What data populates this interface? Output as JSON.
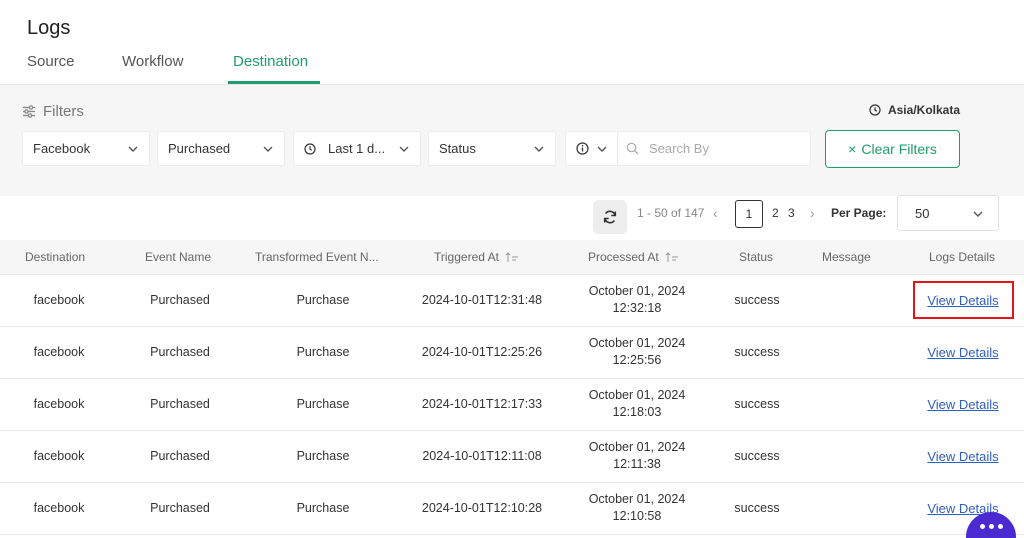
{
  "page": {
    "title": "Logs"
  },
  "tabs": [
    {
      "label": "Source",
      "active": false
    },
    {
      "label": "Workflow",
      "active": false
    },
    {
      "label": "Destination",
      "active": true
    }
  ],
  "filters": {
    "label": "Filters",
    "timezone": "Asia/Kolkata",
    "destination_select": "Facebook",
    "event_select": "Purchased",
    "time_select": "Last 1 d...",
    "status_select": "Status",
    "search_placeholder": "Search By",
    "clear_label": "Clear Filters",
    "clear_icon": "×"
  },
  "pagination": {
    "range_text": "1 - 50 of 147",
    "prev": "‹",
    "next": "›",
    "current_page": "1",
    "pages": [
      "2",
      "3"
    ],
    "per_page_label": "Per Page:",
    "per_page_value": "50"
  },
  "table": {
    "columns": [
      "Destination",
      "Event Name",
      "Transformed Event N...",
      "Triggered At",
      "Processed At",
      "Status",
      "Message",
      "Logs Details"
    ],
    "rows": [
      {
        "destination": "facebook",
        "event_name": "Purchased",
        "transformed": "Purchase",
        "triggered_at": "2024-10-01T12:31:48",
        "processed_date": "October 01, 2024",
        "processed_time": "12:32:18",
        "status": "success",
        "message": "",
        "details": "View Details"
      },
      {
        "destination": "facebook",
        "event_name": "Purchased",
        "transformed": "Purchase",
        "triggered_at": "2024-10-01T12:25:26",
        "processed_date": "October 01, 2024",
        "processed_time": "12:25:56",
        "status": "success",
        "message": "",
        "details": "View Details"
      },
      {
        "destination": "facebook",
        "event_name": "Purchased",
        "transformed": "Purchase",
        "triggered_at": "2024-10-01T12:17:33",
        "processed_date": "October 01, 2024",
        "processed_time": "12:18:03",
        "status": "success",
        "message": "",
        "details": "View Details"
      },
      {
        "destination": "facebook",
        "event_name": "Purchased",
        "transformed": "Purchase",
        "triggered_at": "2024-10-01T12:11:08",
        "processed_date": "October 01, 2024",
        "processed_time": "12:11:38",
        "status": "success",
        "message": "",
        "details": "View Details"
      },
      {
        "destination": "facebook",
        "event_name": "Purchased",
        "transformed": "Purchase",
        "triggered_at": "2024-10-01T12:10:28",
        "processed_date": "October 01, 2024",
        "processed_time": "12:10:58",
        "status": "success",
        "message": "",
        "details": "View Details"
      }
    ]
  },
  "highlight": {
    "color": "#e3141b"
  },
  "colors": {
    "accent": "#1e9e6a",
    "link": "#2f5fbf",
    "chat": "#4b2bd1"
  },
  "icons": [
    "sliders-icon",
    "clock-icon",
    "chevron-down-icon",
    "info-icon",
    "search-icon",
    "refresh-icon",
    "sort-icon",
    "chat-icon"
  ]
}
